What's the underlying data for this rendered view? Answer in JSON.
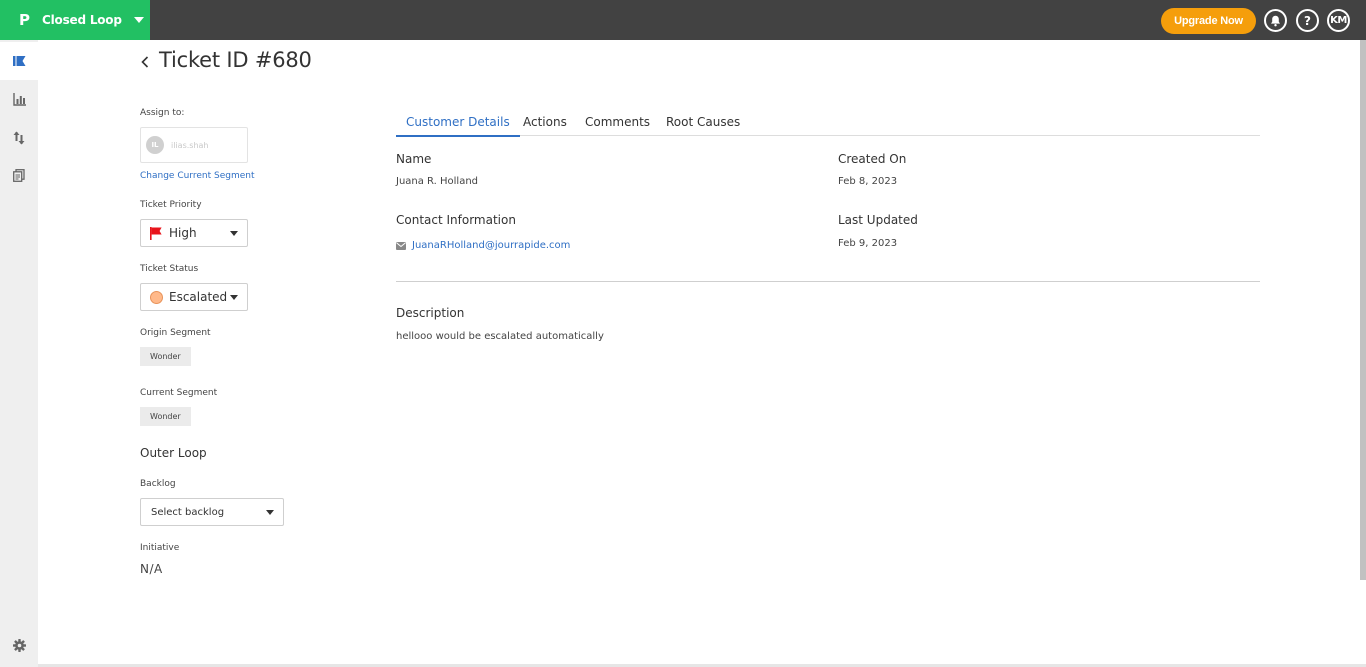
{
  "topbar": {
    "brand_logo": "P",
    "brand_name": "Closed Loop",
    "upgrade_label": "Upgrade Now",
    "help_glyph": "?",
    "user_initials": "KM"
  },
  "sidebar": {
    "items": [
      {
        "icon": "flag-icon",
        "active": true
      },
      {
        "icon": "bar-chart-icon",
        "active": false
      },
      {
        "icon": "transfer-arrows-icon",
        "active": false
      },
      {
        "icon": "documents-icon",
        "active": false
      },
      {
        "icon": "gear-icon",
        "active": false
      }
    ]
  },
  "page": {
    "title": "Ticket ID #680"
  },
  "left_panel": {
    "assign_label": "Assign to:",
    "assignee_initials": "IL",
    "assignee_name": "ilias.shah",
    "change_segment_link": "Change Current Segment",
    "priority_label": "Ticket Priority",
    "priority_value": "High",
    "status_label": "Ticket Status",
    "status_value": "Escalated",
    "origin_segment_label": "Origin Segment",
    "origin_segment_value": "Wonder",
    "current_segment_label": "Current Segment",
    "current_segment_value": "Wonder",
    "outer_loop_title": "Outer Loop",
    "backlog_label": "Backlog",
    "backlog_placeholder": "Select backlog",
    "initiative_label": "Initiative",
    "initiative_value": "N/A"
  },
  "tabs": [
    {
      "label": "Customer Details",
      "active": true
    },
    {
      "label": "Actions",
      "active": false
    },
    {
      "label": "Comments",
      "active": false
    },
    {
      "label": "Root Causes",
      "active": false
    }
  ],
  "customer": {
    "name_label": "Name",
    "name_value": "Juana R. Holland",
    "created_label": "Created On",
    "created_value": "Feb 8, 2023",
    "contact_label": "Contact Information",
    "email": "JuanaRHolland@jourrapide.com",
    "updated_label": "Last Updated",
    "updated_value": "Feb 9, 2023",
    "description_label": "Description",
    "description_value": "hellooo would be escalated automatically"
  },
  "colors": {
    "brand_green": "#22c063",
    "topbar": "#424242",
    "upgrade": "#f59e0b",
    "link_blue": "#2f6fc4",
    "priority_flag": "#e8141b",
    "status_dot": "#ffb98a"
  }
}
